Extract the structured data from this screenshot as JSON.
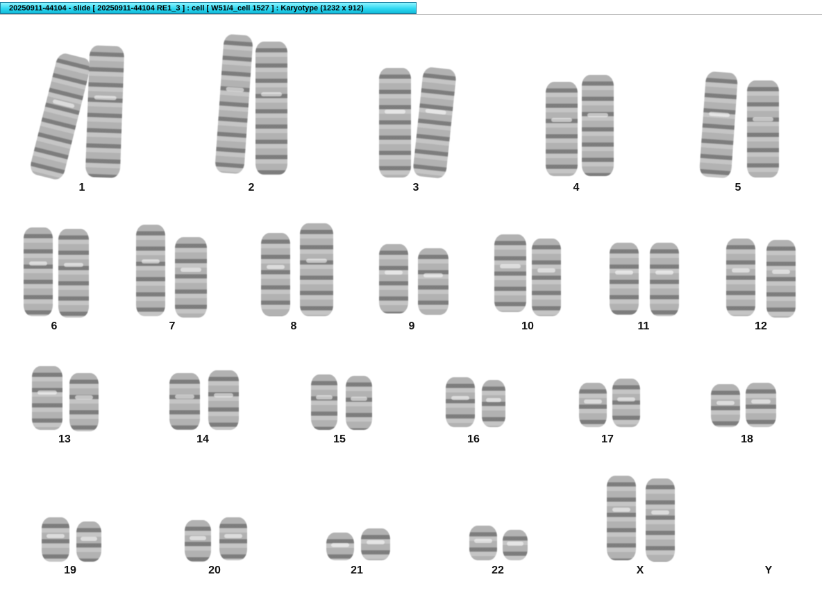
{
  "window": {
    "title": "20250911-44104 - slide [ 20250911-44104 RE1_3 ] : cell [ W51/4_cell 1527 ] : Karyotype  (1232 x 912)"
  },
  "karyotype": {
    "chromosomes": [
      {
        "label": "1"
      },
      {
        "label": "2"
      },
      {
        "label": "3"
      },
      {
        "label": "4"
      },
      {
        "label": "5"
      },
      {
        "label": "6"
      },
      {
        "label": "7"
      },
      {
        "label": "8"
      },
      {
        "label": "9"
      },
      {
        "label": "10"
      },
      {
        "label": "11"
      },
      {
        "label": "12"
      },
      {
        "label": "13"
      },
      {
        "label": "14"
      },
      {
        "label": "15"
      },
      {
        "label": "16"
      },
      {
        "label": "17"
      },
      {
        "label": "18"
      },
      {
        "label": "19"
      },
      {
        "label": "20"
      },
      {
        "label": "21"
      },
      {
        "label": "22"
      },
      {
        "label": "X"
      },
      {
        "label": "Y"
      }
    ]
  }
}
